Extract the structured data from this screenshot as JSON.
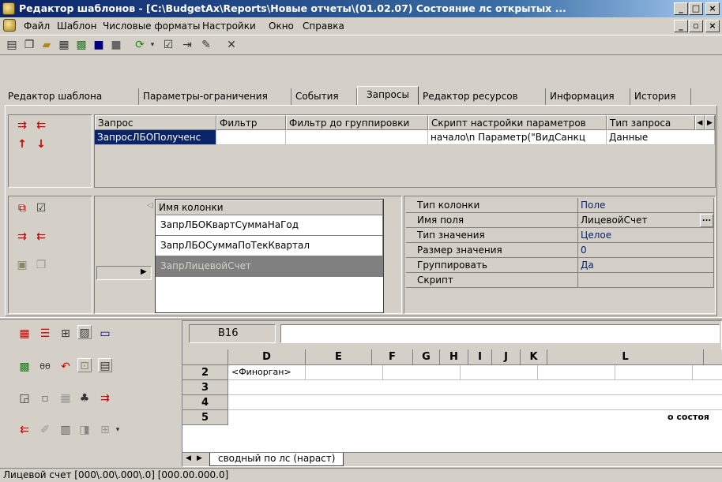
{
  "window": {
    "title": "Редактор шаблонов - [C:\\BudgetAx\\Reports\\Новые отчеты\\(01.02.07) Состояние лс открытых ..."
  },
  "menu": {
    "items": [
      {
        "label": "Файл"
      },
      {
        "label": "Шаблон"
      },
      {
        "label": "Числовые форматы"
      },
      {
        "label": "Настройки"
      },
      {
        "label": "Окно"
      },
      {
        "label": "Справка"
      }
    ]
  },
  "tabs": [
    {
      "label": "Редактор шаблона"
    },
    {
      "label": "Параметры-ограничения"
    },
    {
      "label": "События"
    },
    {
      "label": "Запросы"
    },
    {
      "label": "Редактор ресурсов"
    },
    {
      "label": "Информация"
    },
    {
      "label": "История"
    }
  ],
  "query_grid": {
    "columns": [
      "Запрос",
      "Фильтр",
      "Фильтр до группировки",
      "Скрипт настройки параметров",
      "Тип запроса"
    ],
    "rows": [
      [
        "ЗапросЛБОПолученс",
        "",
        "",
        "начало\\n  Параметр(\"ВидСанкц",
        "Данные"
      ]
    ]
  },
  "columns_grid": {
    "header": "Имя колонки",
    "rows": [
      "ЗапрЛБОКвартСуммаНаГод",
      "ЗапрЛБОСуммаПоТекКвартал",
      "ЗапрЛицевойСчет"
    ]
  },
  "properties": {
    "rows": [
      {
        "name": "Тип колонки",
        "value": "Поле"
      },
      {
        "name": "Имя поля",
        "value": "ЛицевойСчет"
      },
      {
        "name": "Тип значения",
        "value": "Целое"
      },
      {
        "name": "Размер значения",
        "value": "0"
      },
      {
        "name": "Группировать",
        "value": "Да"
      },
      {
        "name": "Скрипт",
        "value": ""
      }
    ],
    "ellipsis": "..."
  },
  "sheet": {
    "cell_ref": "B16",
    "formula": "",
    "columns": [
      "D",
      "E",
      "F",
      "G",
      "H",
      "I",
      "J",
      "K",
      "L"
    ],
    "rows": [
      "2",
      "3",
      "4",
      "5"
    ],
    "d2": "<Финорган>",
    "row5_text": "о состоя",
    "sheet_tab": "сводный по лс (нараст)"
  },
  "status": {
    "text": "Лицевой счет [000\\.00\\.000\\.0] [000.00.000.0]"
  }
}
